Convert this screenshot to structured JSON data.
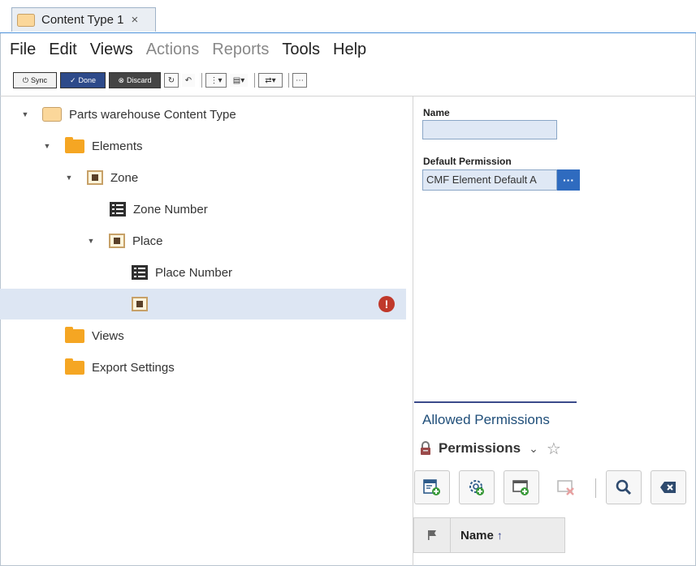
{
  "tab": {
    "title": "Content Type 1",
    "close_glyph": "×"
  },
  "menu": {
    "items": [
      {
        "label": "File",
        "enabled": true
      },
      {
        "label": "Edit",
        "enabled": true
      },
      {
        "label": "Views",
        "enabled": true
      },
      {
        "label": "Actions",
        "enabled": false
      },
      {
        "label": "Reports",
        "enabled": false
      },
      {
        "label": "Tools",
        "enabled": true
      },
      {
        "label": "Help",
        "enabled": true
      }
    ]
  },
  "toolbar": {
    "sync_label": "Sync",
    "done_label": "Done",
    "discard_label": "Discard"
  },
  "tree": {
    "root": "Parts warehouse Content Type",
    "elements": "Elements",
    "zone": "Zone",
    "zone_number": "Zone Number",
    "place": "Place",
    "place_number": "Place Number",
    "unnamed": "",
    "views": "Views",
    "export_settings": "Export Settings",
    "error_glyph": "!"
  },
  "properties": {
    "name_label": "Name",
    "name_value": "",
    "default_permission_label": "Default Permission",
    "default_permission_value": "CMF Element Default A",
    "ellipsis": "···"
  },
  "allowed_permissions": {
    "title": "Allowed Permissions",
    "header_label": "Permissions",
    "chevron": "⌄",
    "star": "☆",
    "grid_column": "Name",
    "sort_glyph": "↑"
  },
  "colors": {
    "accent": "#2f6bbf",
    "folder": "#f5a623",
    "selection": "#dde6f3",
    "error": "#c0392b"
  }
}
